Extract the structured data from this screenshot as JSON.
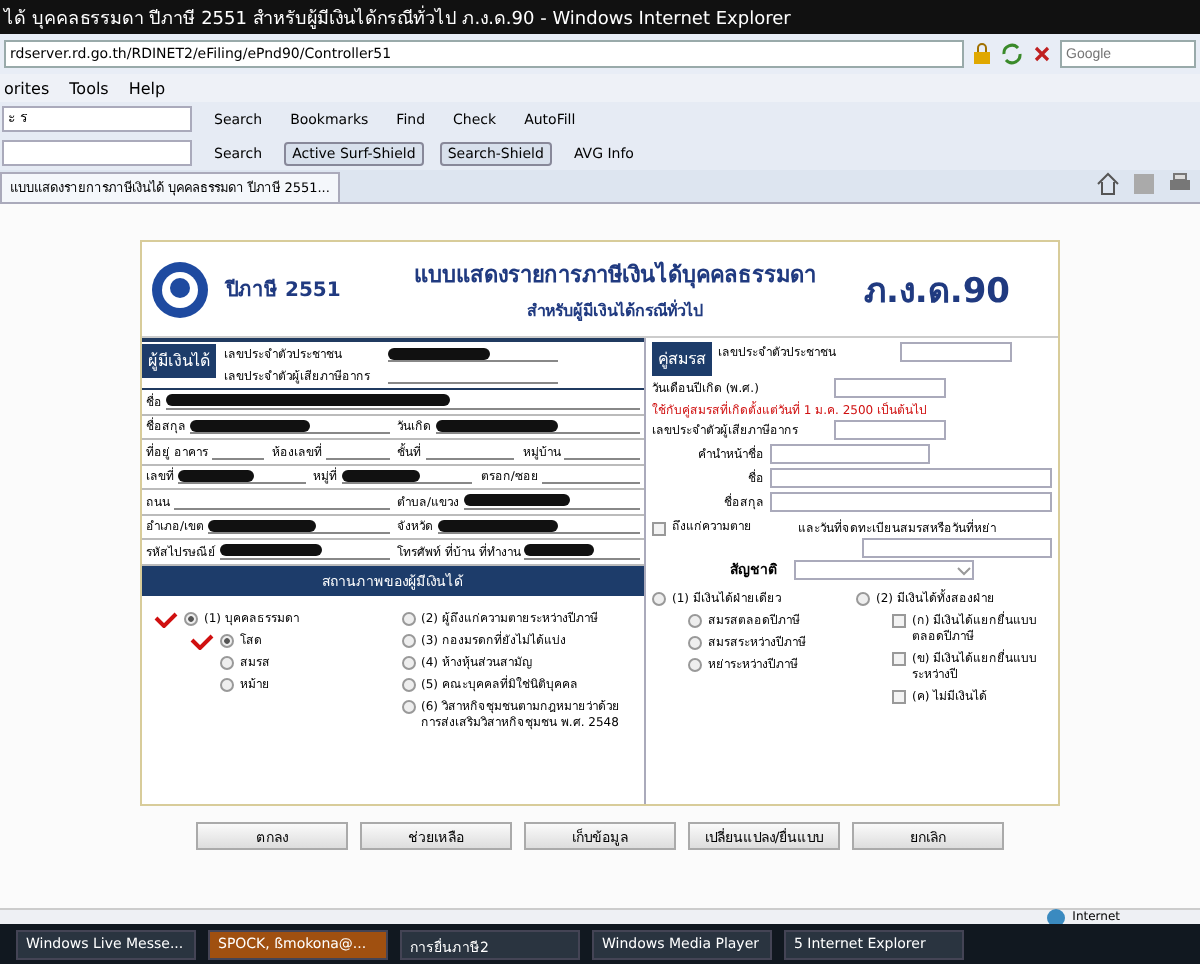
{
  "window": {
    "title": "ได้ บุคคลธรรมดา ปีภาษี 2551 สำหรับผู้มีเงินได้กรณีทั่วไป ภ.ง.ด.90 - Windows Internet Explorer"
  },
  "address_bar": {
    "url": "rdserver.rd.go.th/RDINET2/eFiling/ePnd90/Controller51",
    "search_placeholder": "Google"
  },
  "menu": [
    "orites",
    "Tools",
    "Help"
  ],
  "toolbar_1": {
    "field": "ะ ร",
    "items": [
      "Search",
      "Bookmarks",
      "Find",
      "Check",
      "AutoFill"
    ]
  },
  "toolbar_2": {
    "items": [
      "Search",
      "Active Surf-Shield",
      "Search-Shield",
      "AVG Info"
    ]
  },
  "tab": {
    "label": "แบบแสดงรายการภาษีเงินได้ บุคคลธรรมดา ปีภาษี 2551..."
  },
  "form": {
    "year": "ปีภาษี 2551",
    "title": "แบบแสดงรายการภาษีเงินได้บุคคลธรรมดา",
    "subtitle": "สำหรับผู้มีเงินได้กรณีทั่วไป",
    "code": "ภ.ง.ด.90",
    "taxpayer": {
      "header": "ผู้มีเงินได้",
      "ids": [
        {
          "label": "เลขประจำตัวประชาชน",
          "redacted": true
        },
        {
          "label": "เลขประจำตัวผู้เสียภาษีอากร",
          "redacted": false
        }
      ],
      "rows": [
        {
          "fields": [
            {
              "label": "ชื่อ",
              "redacted": true
            }
          ]
        },
        {
          "fields": [
            {
              "label": "ชื่อสกุล",
              "redacted": true
            },
            {
              "label": "วันเกิด",
              "redacted": true
            }
          ]
        },
        {
          "fields": [
            {
              "label": "ที่อยู่ อาคาร",
              "redacted": false
            },
            {
              "label": "ห้องเลขที่",
              "redacted": false
            },
            {
              "label": "ชั้นที่",
              "redacted": false
            },
            {
              "label": "หมู่บ้าน",
              "redacted": false
            }
          ]
        },
        {
          "fields": [
            {
              "label": "เลขที่",
              "redacted": true
            },
            {
              "label": "หมู่ที่",
              "redacted": true
            },
            {
              "label": "ตรอก/ซอย",
              "redacted": false
            }
          ]
        },
        {
          "fields": [
            {
              "label": "ถนน",
              "redacted": false
            },
            {
              "label": "ตำบล/แขวง",
              "redacted": true
            }
          ]
        },
        {
          "fields": [
            {
              "label": "อำเภอ/เขต",
              "redacted": true
            },
            {
              "label": "จังหวัด",
              "redacted": true
            }
          ]
        },
        {
          "fields": [
            {
              "label": "รหัสไปรษณีย์",
              "redacted": true
            },
            {
              "label": "โทรศัพท์ ที่บ้าน ที่ทำงาน",
              "redacted": true
            }
          ]
        }
      ]
    },
    "status": {
      "header": "สถานภาพของผู้มีเงินได้",
      "left": [
        {
          "label": "(1) บุคคลธรรมดา",
          "selected": true,
          "ticked": true,
          "children": [
            {
              "label": "โสด",
              "selected": true,
              "ticked": true
            },
            {
              "label": "สมรส",
              "selected": false,
              "ticked": false
            },
            {
              "label": "หม้าย",
              "selected": false,
              "ticked": false
            }
          ]
        }
      ],
      "right": [
        {
          "label": "(2) ผู้ถึงแก่ความตายระหว่างปีภาษี",
          "selected": false
        },
        {
          "label": "(3) กองมรดกที่ยังไม่ได้แบ่ง",
          "selected": false
        },
        {
          "label": "(4) ห้างหุ้นส่วนสามัญ",
          "selected": false
        },
        {
          "label": "(5) คณะบุคคลที่มิใช่นิติบุคคล",
          "selected": false
        },
        {
          "label": "(6) วิสาหกิจชุมชนตามกฎหมายว่าด้วยการส่งเสริมวิสาหกิจชุมชน พ.ศ. 2548",
          "selected": false
        }
      ]
    },
    "spouse": {
      "header": "คู่สมรส",
      "rows": [
        {
          "kind": "input",
          "label": "เลขประจำตัวประชาชน"
        },
        {
          "kind": "input",
          "label": "วันเดือนปีเกิด (พ.ศ.)"
        },
        {
          "kind": "note",
          "label": "ใช้กับคู่สมรสที่เกิดตั้งแต่วันที่ 1 ม.ค. 2500 เป็นต้นไป"
        },
        {
          "kind": "input",
          "label": "เลขประจำตัวผู้เสียภาษีอากร"
        },
        {
          "kind": "short",
          "label": "คำนำหน้าชื่อ"
        },
        {
          "kind": "long",
          "label": "ชื่อ"
        },
        {
          "kind": "long",
          "label": "ชื่อสกุล"
        }
      ],
      "deceased": {
        "label": "ถึงแก่ความตาย",
        "checked": false
      },
      "date_label": "และวันที่จดทะเบียนสมรสหรือวันที่หย่า",
      "nationality": {
        "label": "สัญชาติ"
      },
      "options_left": [
        {
          "label": "(1) มีเงินได้ฝ่ายเดียว",
          "selected": false,
          "children": [
            {
              "label": "สมรสตลอดปีภาษี",
              "selected": false
            },
            {
              "label": "สมรสระหว่างปีภาษี",
              "selected": false
            },
            {
              "label": "หย่าระหว่างปีภาษี",
              "selected": false
            }
          ]
        }
      ],
      "options_right": [
        {
          "label": "(2) มีเงินได้ทั้งสองฝ่าย",
          "selected": false,
          "children": [
            {
              "label": "(ก) มีเงินได้แยกยื่นแบบตลอดปีภาษี",
              "checked": false
            },
            {
              "label": "(ข) มีเงินได้แยกยื่นแบบระหว่างปี",
              "checked": false
            },
            {
              "label": "(ค) ไม่มีเงินได้",
              "checked": false
            }
          ]
        }
      ]
    }
  },
  "buttons": [
    "ตกลง",
    "ช่วยเหลือ",
    "เก็บข้อมูล",
    "เปลี่ยนแปลง/ยื่นแบบ",
    "ยกเลิก"
  ],
  "status_bar": {
    "zone": "Internet"
  },
  "taskbar": [
    {
      "label": "Windows Live Messe...",
      "selected": false
    },
    {
      "label": "SPOCK, ßmokona@...",
      "selected": true
    },
    {
      "label": "การยื่นภาษี2",
      "selected": false
    },
    {
      "label": "Windows Media Player",
      "selected": false
    },
    {
      "label": "5 Internet Explorer",
      "selected": false
    }
  ]
}
